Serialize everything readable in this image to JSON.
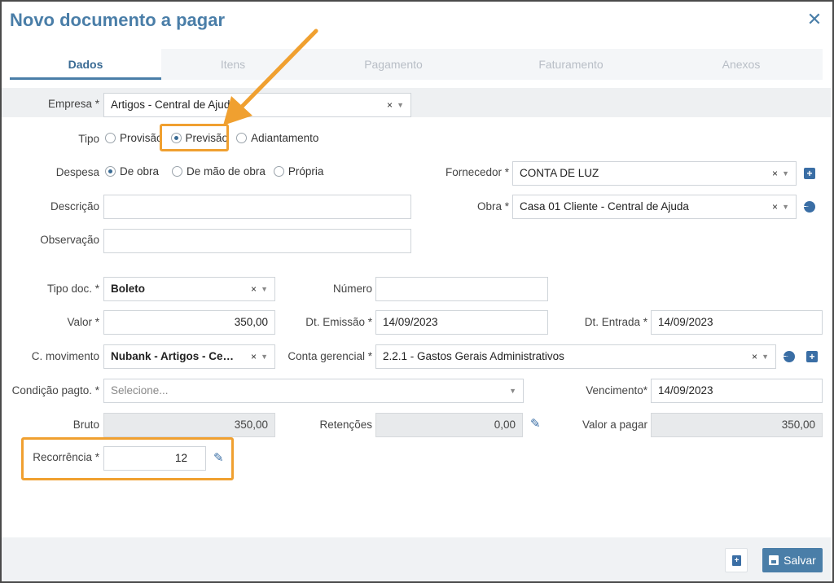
{
  "dialog": {
    "title": "Novo documento a pagar"
  },
  "tabs": [
    {
      "label": "Dados",
      "active": true
    },
    {
      "label": "Itens",
      "active": false
    },
    {
      "label": "Pagamento",
      "active": false
    },
    {
      "label": "Faturamento",
      "active": false
    },
    {
      "label": "Anexos",
      "active": false
    }
  ],
  "form": {
    "empresa": {
      "label": "Empresa *",
      "value": "Artigos - Central de Ajuda",
      "clear": "×",
      "caret": "▼"
    },
    "tipo": {
      "label": "Tipo",
      "options": [
        "Provisão",
        "Previsão",
        "Adiantamento"
      ],
      "selected": "Previsão"
    },
    "despesa": {
      "label": "Despesa",
      "options": [
        "De obra",
        "De mão de obra",
        "Própria"
      ],
      "selected": "De obra"
    },
    "fornecedor": {
      "label": "Fornecedor *",
      "value": "CONTA DE LUZ",
      "clear": "×",
      "caret": "▼"
    },
    "descricao": {
      "label": "Descrição",
      "value": ""
    },
    "obra": {
      "label": "Obra *",
      "value": "Casa 01 Cliente - Central de Ajuda",
      "clear": "×",
      "caret": "▼"
    },
    "observacao": {
      "label": "Observação",
      "value": ""
    },
    "tipo_doc": {
      "label": "Tipo doc. *",
      "value": "Boleto",
      "clear": "×",
      "caret": "▼"
    },
    "numero": {
      "label": "Número",
      "value": ""
    },
    "valor": {
      "label": "Valor *",
      "value": "350,00"
    },
    "dt_emissao": {
      "label": "Dt. Emissão *",
      "value": "14/09/2023"
    },
    "dt_entrada": {
      "label": "Dt. Entrada *",
      "value": "14/09/2023"
    },
    "c_movimento": {
      "label": "C. movimento",
      "value": "Nubank - Artigos - Centra...",
      "clear": "×",
      "caret": "▼"
    },
    "conta_gerencial": {
      "label": "Conta gerencial *",
      "value": "2.2.1 - Gastos Gerais Administrativos",
      "clear": "×",
      "caret": "▼"
    },
    "condicao_pagto": {
      "label": "Condição pagto. *",
      "placeholder": "Selecione...",
      "caret": "▼"
    },
    "vencimento": {
      "label": "Vencimento*",
      "value": "14/09/2023"
    },
    "bruto": {
      "label": "Bruto",
      "value": "350,00"
    },
    "retencoes": {
      "label": "Retenções",
      "value": "0,00"
    },
    "valor_a_pagar": {
      "label": "Valor a pagar",
      "value": "350,00"
    },
    "recorrencia": {
      "label": "Recorrência *",
      "value": "12"
    }
  },
  "footer": {
    "save_label": "Salvar"
  },
  "colors": {
    "accent": "#4a7ea8",
    "highlight": "#f0a030",
    "icon": "#3a6ea5"
  }
}
